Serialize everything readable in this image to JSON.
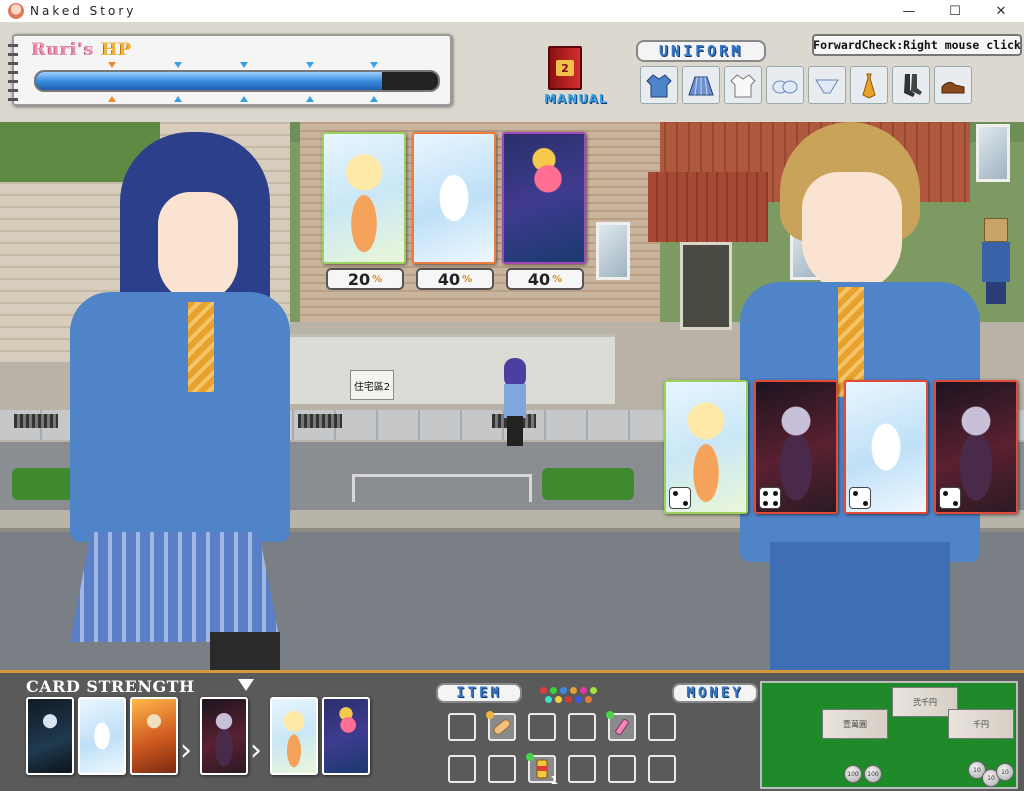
{
  "window": {
    "title": "Naked Story",
    "controls": {
      "minimize": "—",
      "maximize": "☐",
      "close": "✕"
    }
  },
  "hud": {
    "hp": {
      "title_name": "Ruri's",
      "title_suffix": "HP",
      "fraction": 0.86
    },
    "manual": {
      "number": "2",
      "label": "MANUAL"
    },
    "uniform": {
      "label": "UNIFORM",
      "items": [
        "jacket-icon",
        "skirt-icon",
        "shirt-icon",
        "bra-icon",
        "panties-icon",
        "tie-icon",
        "socks-icon",
        "shoes-icon"
      ]
    },
    "forward_check": "ForwardCheck:Right mouse click"
  },
  "scene": {
    "nameplate": "住宅區2",
    "opponent_cards": [
      {
        "art": "angel",
        "border": "green",
        "percent": "20"
      },
      {
        "art": "dragon",
        "border": "orange",
        "percent": "40"
      },
      {
        "art": "demon-girl",
        "border": "purple",
        "percent": "40"
      }
    ],
    "player_cards": [
      {
        "art": "angel",
        "border": "green"
      },
      {
        "art": "vampire",
        "border": "red"
      },
      {
        "art": "dragon",
        "border": "red"
      },
      {
        "art": "vampire",
        "border": "red"
      }
    ],
    "percent_sign": "%"
  },
  "bottom": {
    "card_strength_label": "CARD STRENGTH",
    "strength_cards": [
      "reaper",
      "dragon",
      "knight",
      "vampire",
      "angel",
      "demon-girl"
    ],
    "item_label": "ITEM",
    "money_label": "MONEY",
    "items": [
      {
        "row": 0,
        "col": 0,
        "icon": ""
      },
      {
        "row": 0,
        "col": 1,
        "icon": "bandage-icon"
      },
      {
        "row": 0,
        "col": 2,
        "icon": ""
      },
      {
        "row": 0,
        "col": 3,
        "icon": ""
      },
      {
        "row": 0,
        "col": 4,
        "icon": "lipstick-icon"
      },
      {
        "row": 0,
        "col": 5,
        "icon": ""
      },
      {
        "row": 1,
        "col": 0,
        "icon": ""
      },
      {
        "row": 1,
        "col": 1,
        "icon": ""
      },
      {
        "row": 1,
        "col": 2,
        "icon": "drink-can-icon",
        "count": "1"
      },
      {
        "row": 1,
        "col": 3,
        "icon": ""
      },
      {
        "row": 1,
        "col": 4,
        "icon": ""
      },
      {
        "row": 1,
        "col": 5,
        "icon": ""
      }
    ],
    "money": {
      "bills": [
        "壹萬圓",
        "弐千円",
        "千円"
      ],
      "coins_left": [
        "100",
        "100"
      ],
      "coins_right": [
        "10",
        "10",
        "10"
      ]
    }
  }
}
